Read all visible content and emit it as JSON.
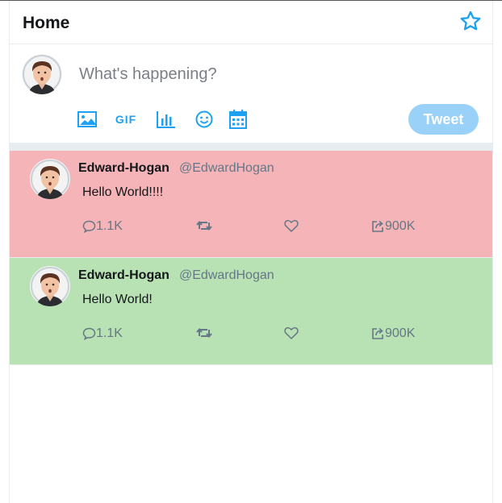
{
  "header": {
    "title": "Home",
    "star_icon": "star-icon"
  },
  "composer": {
    "placeholder": "What's happening?",
    "tools": [
      "image-icon",
      "gif-icon",
      "poll-icon",
      "emoji-icon",
      "schedule-icon"
    ],
    "gif_label": "GIF",
    "tweet_button": "Tweet"
  },
  "colors": {
    "accent": "#1da1f2",
    "tweet_button_disabled": "#9ad1f9",
    "tweet1_bg": "#f4b4b8",
    "tweet2_bg": "#b8e2b3"
  },
  "tweets": [
    {
      "name": "Edward-Hogan",
      "handle": "@EdwardHogan",
      "text": "Hello World!!!!",
      "replies": "1.1K",
      "shares": "900K"
    },
    {
      "name": "Edward-Hogan",
      "handle": "@EdwardHogan",
      "text": "Hello World!",
      "replies": "1.1K",
      "shares": "900K"
    }
  ]
}
